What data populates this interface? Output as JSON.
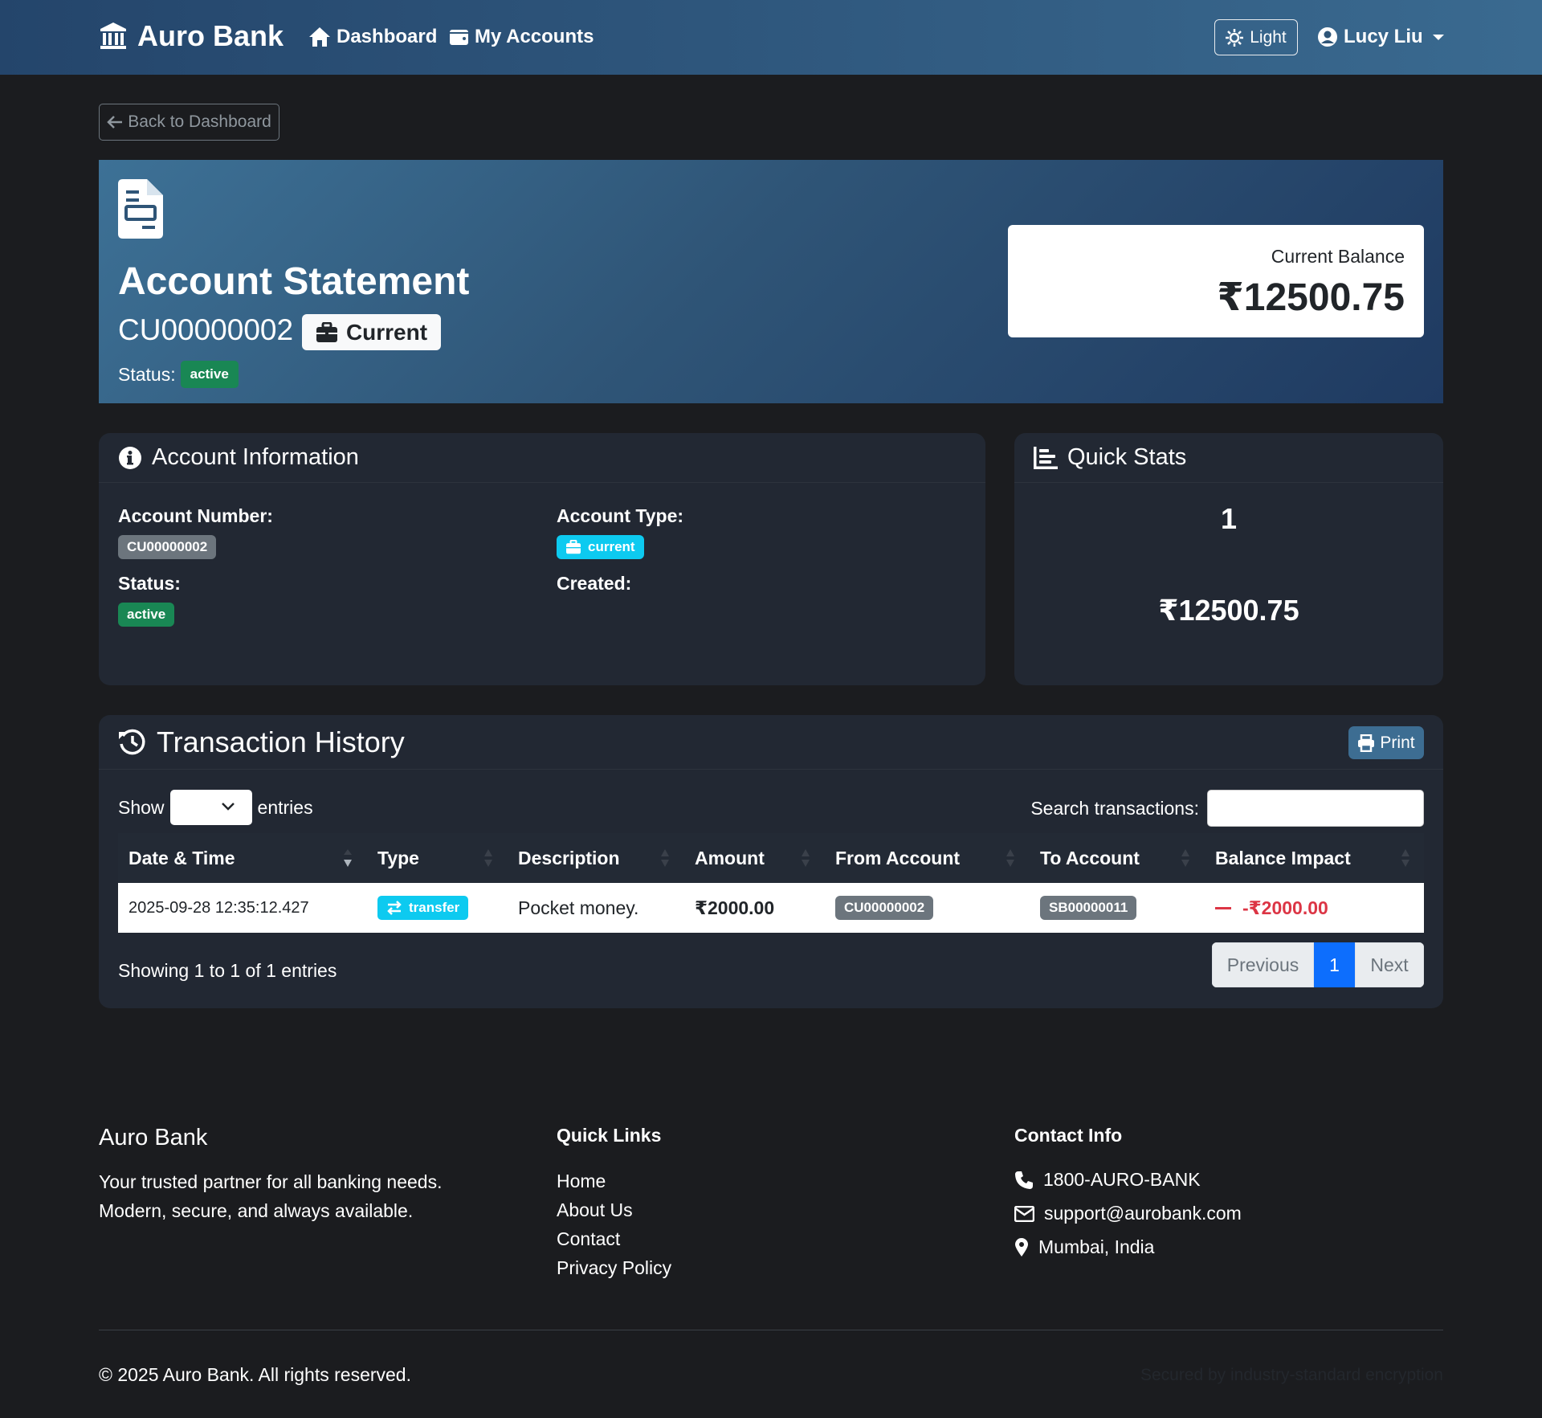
{
  "navbar": {
    "brand": "Auro Bank",
    "links": [
      "Dashboard",
      "My Accounts"
    ],
    "theme_label": "Light",
    "user_name": "Lucy Liu"
  },
  "back_label": "Back to Dashboard",
  "hero": {
    "title": "Account Statement",
    "account_number": "CU00000002",
    "account_type": "Current",
    "status_label": "Status:",
    "status": "active",
    "balance_label": "Current Balance",
    "balance": "₹12500.75"
  },
  "account_info": {
    "title": "Account Information",
    "number_label": "Account Number:",
    "number": "CU00000002",
    "type_label": "Account Type:",
    "type": "current",
    "status_label": "Status:",
    "status": "active",
    "created_label": "Created:"
  },
  "quick_stats": {
    "title": "Quick Stats",
    "transactions": "1",
    "transactions_label": "",
    "balance": "₹12500.75",
    "balance_label": ""
  },
  "transactions": {
    "title": "Transaction History",
    "print_label": "Print",
    "show_label": "Show",
    "entries_label": "entries",
    "search_label": "Search transactions:",
    "columns": [
      "Date & Time",
      "Type",
      "Description",
      "Amount",
      "From Account",
      "To Account",
      "Balance Impact"
    ],
    "rows": [
      {
        "date": "2025-09-28 12:35:12.427",
        "type": "transfer",
        "description": "Pocket money.",
        "amount": "₹2000.00",
        "from": "CU00000002",
        "to": "SB00000011",
        "impact": "-₹2000.00"
      }
    ],
    "showing_text": "Showing 1 to 1 of 1 entries",
    "pager": {
      "previous": "Previous",
      "current": "1",
      "next": "Next"
    }
  },
  "footer": {
    "brand": "Auro Bank",
    "tagline_1": "Your trusted partner for all banking needs.",
    "tagline_2": "Modern, secure, and always available.",
    "quick_links_title": "Quick Links",
    "quick_links": [
      "Home",
      "About Us",
      "Contact",
      "Privacy Policy"
    ],
    "contact_title": "Contact Info",
    "phone": "1800-AURO-BANK",
    "email": "support@aurobank.com",
    "location": "Mumbai, India",
    "copyright": "© 2025 Auro Bank. All rights reserved.",
    "secured": "Secured by industry-standard encryption"
  },
  "colors": {
    "accent": "#3d6d92",
    "success": "#198754",
    "info": "#0dcaf0",
    "danger": "#dc3545",
    "primary": "#0d6efd"
  }
}
